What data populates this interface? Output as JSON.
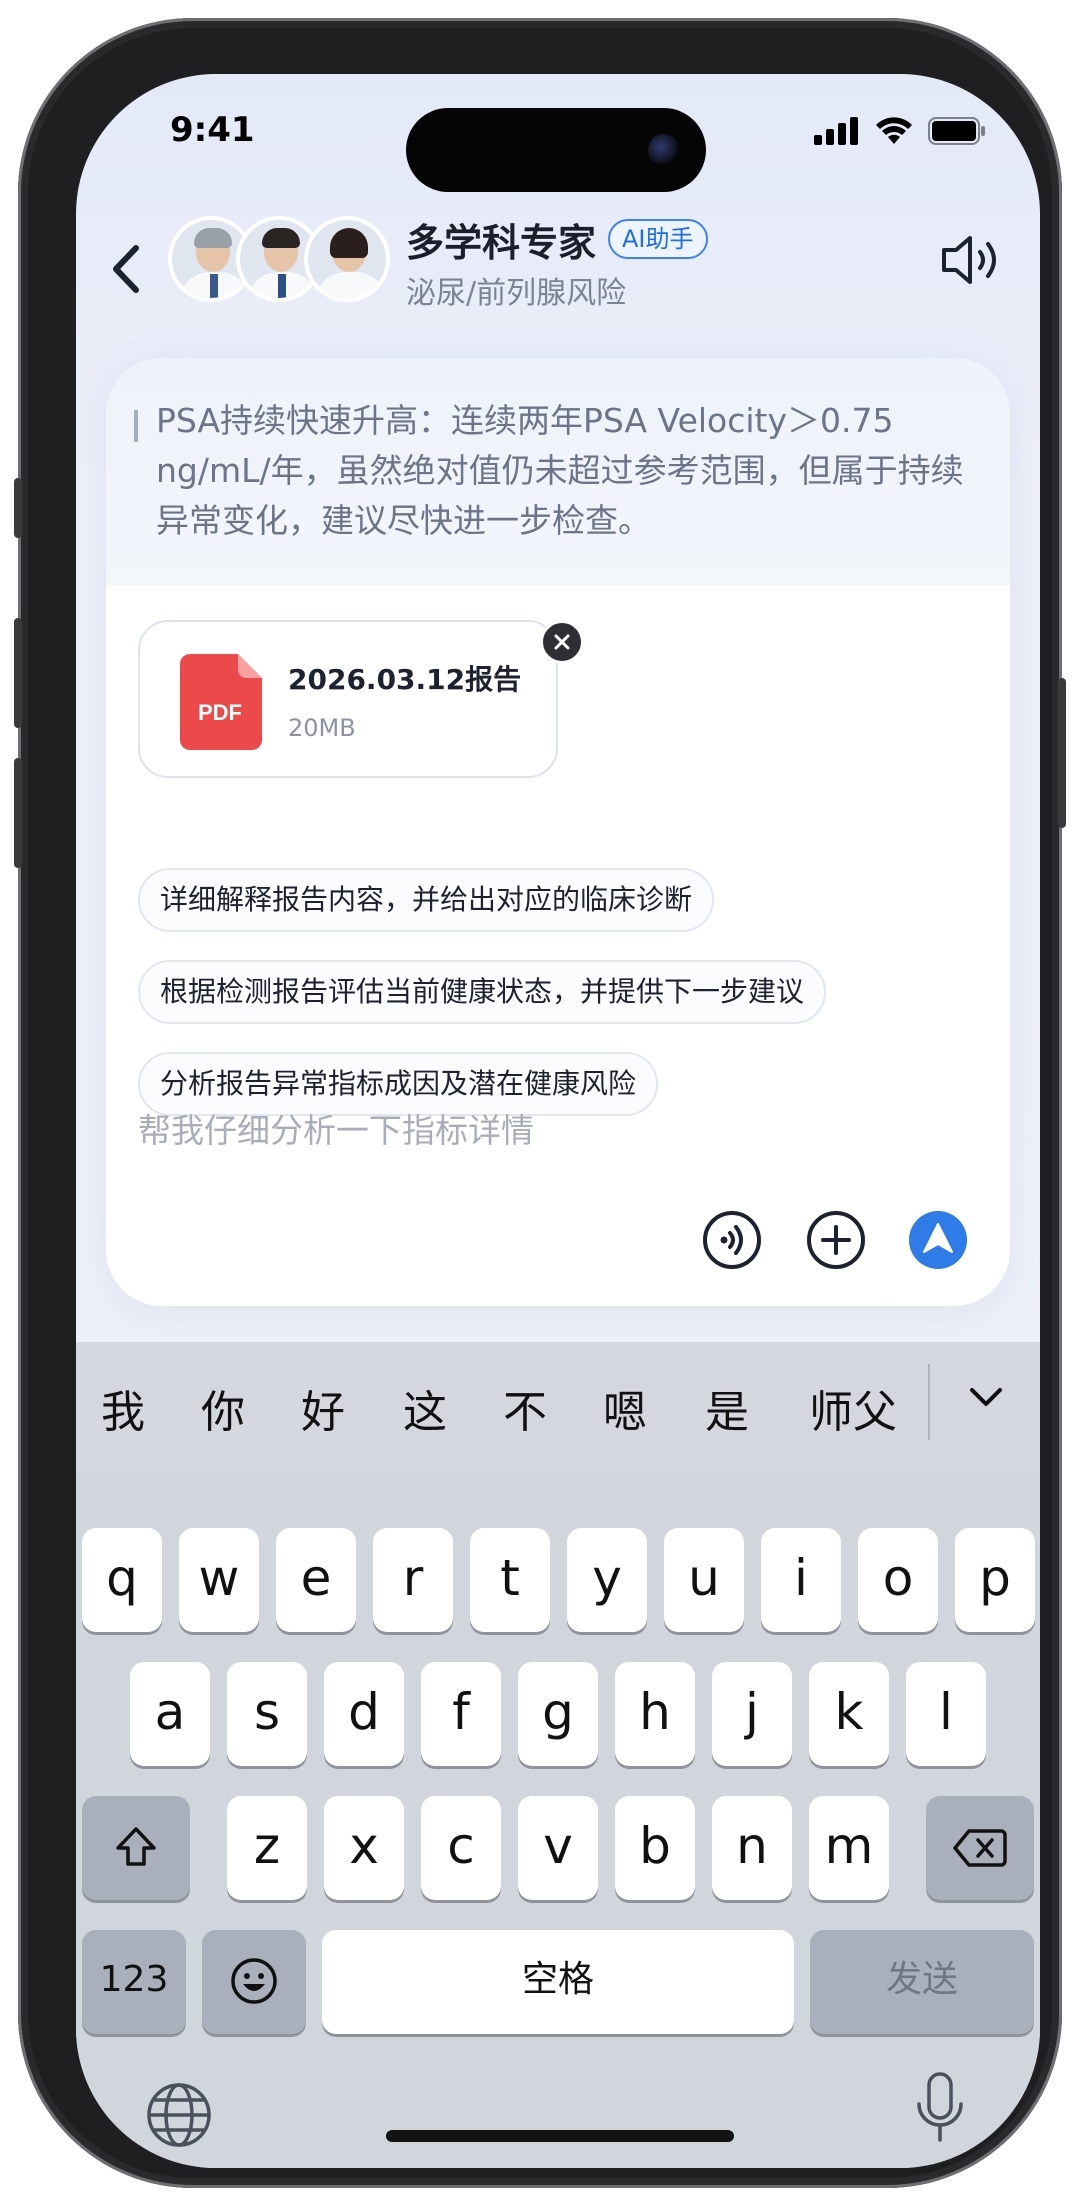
{
  "status_bar": {
    "time": "9:41"
  },
  "header": {
    "title": "多学科专家",
    "badge": "AI助手",
    "subtitle": "泌尿/前列腺风险"
  },
  "quote": {
    "text": "PSA持续快速升高：连续两年PSA Velocity＞0.75 ng/mL/年，虽然绝对值仍未超过参考范围，但属于持续异常变化，建议尽快进一步检查。"
  },
  "attachment": {
    "name": "2026.03.12报告",
    "size": "20MB",
    "type_label": "PDF"
  },
  "suggestions": [
    "详细解释报告内容，并给出对应的临床诊断",
    "根据检测报告评估当前健康状态，并提供下一步建议",
    "分析报告异常指标成因及潜在健康风险"
  ],
  "input": {
    "placeholder": "帮我仔细分析一下指标详情"
  },
  "keyboard": {
    "candidates": [
      "我",
      "你",
      "好",
      "这",
      "不",
      "嗯",
      "是",
      "师父"
    ],
    "row1": [
      "q",
      "w",
      "e",
      "r",
      "t",
      "y",
      "u",
      "i",
      "o",
      "p"
    ],
    "row2": [
      "a",
      "s",
      "d",
      "f",
      "g",
      "h",
      "j",
      "k",
      "l"
    ],
    "row3": [
      "z",
      "x",
      "c",
      "v",
      "b",
      "n",
      "m"
    ],
    "numbers_label": "123",
    "space_label": "空格",
    "send_label": "发送"
  },
  "colors": {
    "accent": "#1f6fe0",
    "send_button": "#2f7be8",
    "pdf_red": "#ec4a4a"
  }
}
